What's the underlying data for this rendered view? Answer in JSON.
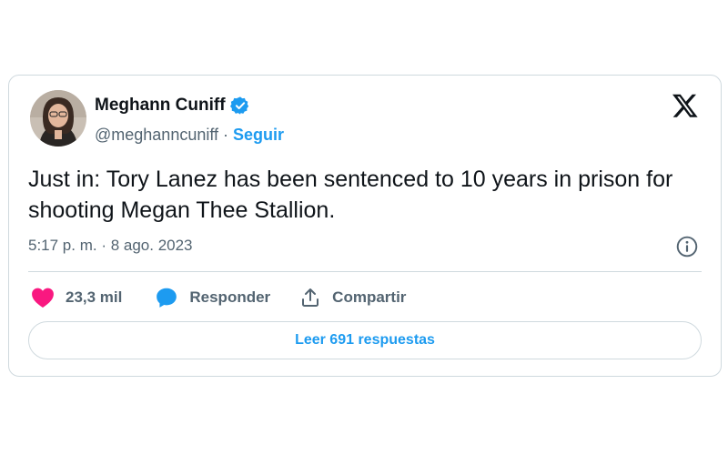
{
  "author": {
    "name": "Meghann Cuniff",
    "handle": "@meghanncuniff",
    "separator": "·",
    "follow_label": "Seguir"
  },
  "tweet": {
    "text": "Just in: Tory Lanez has been sentenced to 10 years in prison for shooting Megan Thee Stallion.",
    "timestamp": "5:17 p. m. · 8 ago. 2023"
  },
  "actions": {
    "like_count": "23,3 mil",
    "reply_label": "Responder",
    "share_label": "Compartir"
  },
  "footer": {
    "read_replies_label": "Leer 691 respuestas"
  },
  "colors": {
    "accent": "#1d9bf0",
    "like": "#f91880",
    "text": "#0f1419",
    "secondary": "#536471",
    "border": "#cfd9de"
  },
  "icons": [
    "verified-badge-icon",
    "x-logo-icon",
    "info-icon",
    "heart-icon",
    "reply-bubble-icon",
    "share-icon"
  ]
}
